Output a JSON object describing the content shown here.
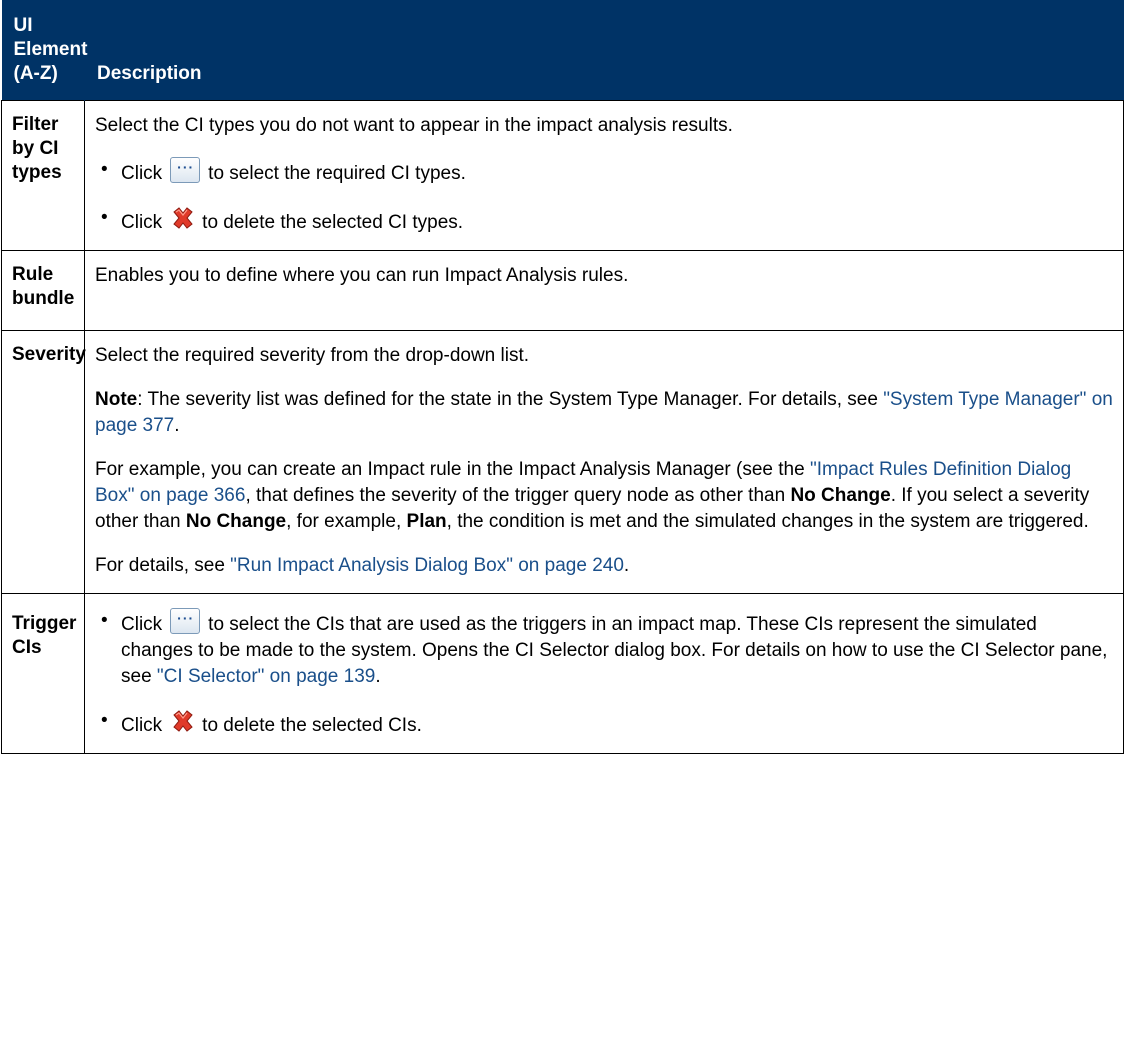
{
  "header": {
    "col1": "UI Element (A-Z)",
    "col2": "Description"
  },
  "rows": {
    "filter": {
      "name": "Filter by CI types",
      "intro": "Select the CI types you do not want to appear in the impact analysis results.",
      "b1_pre": "Click",
      "b1_post": "to select the required CI types.",
      "b2_pre": "Click",
      "b2_post": "to delete the selected CI types."
    },
    "rule": {
      "name": "Rule bundle",
      "text": "Enables you to define where you can run Impact Analysis rules."
    },
    "severity": {
      "name": "Severity",
      "p1": "Select the required severity from the drop-down list.",
      "note_label": "Note",
      "note_text": ": The severity list was defined for the state in the System Type Manager. For details, see ",
      "note_link": "\"System Type Manager\" on page 377",
      "note_end": ".",
      "ex_1": "For example, you can create an Impact rule in the Impact Analysis Manager (see the ",
      "ex_link": "\"Impact Rules Definition Dialog Box\" on page 366",
      "ex_2": ", that defines the severity of the trigger query node as other than ",
      "ex_b1": "No Change",
      "ex_3": ". If you select a severity other than ",
      "ex_b2": "No Change",
      "ex_4": ", for example, ",
      "ex_b3": "Plan",
      "ex_5": ", the condition is met and the simulated changes in the system are triggered.",
      "det_1": "For details, see ",
      "det_link": "\"Run Impact Analysis Dialog Box\" on page 240",
      "det_end": "."
    },
    "trigger": {
      "name": "Trigger CIs",
      "b1_pre": "Click",
      "b1_post": "to select the CIs that are used as the triggers in an impact map. These CIs represent the simulated changes to be made to the system. Opens the CI Selector dialog box. For details on how to use the CI Selector pane, see ",
      "b1_link": "\"CI Selector\" on page 139",
      "b1_end": ".",
      "b2_pre": "Click",
      "b2_post": "to delete the selected CIs."
    }
  },
  "icons": {
    "browse": "ellipsis-button-icon",
    "delete": "red-x-delete-icon"
  },
  "colors": {
    "header_bg": "#003366",
    "header_text": "#ffffff",
    "link": "#1a4f8a"
  }
}
